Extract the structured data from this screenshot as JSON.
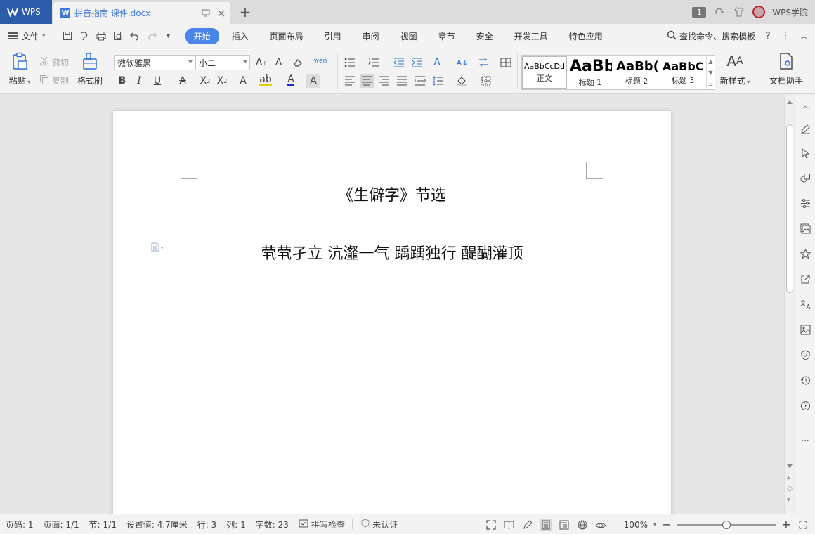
{
  "tabbar": {
    "home_label": "WPS",
    "doc_tab_title": "拼音指南 课件.docx",
    "window_count": "1",
    "academy_label": "WPS学院"
  },
  "menubar": {
    "file_label": "文件",
    "tabs": [
      "开始",
      "插入",
      "页面布局",
      "引用",
      "审阅",
      "视图",
      "章节",
      "安全",
      "开发工具",
      "特色应用"
    ],
    "active_tab": "开始",
    "search_label": "查找命令、搜索模板"
  },
  "ribbon": {
    "paste_label": "粘贴",
    "cut_label": "剪切",
    "copy_label": "复制",
    "format_painter_label": "格式刷",
    "font_name": "微软雅黑",
    "font_size": "小二",
    "styles": [
      {
        "sample": "AaBbCcDd",
        "name": "正文"
      },
      {
        "sample": "AaBb",
        "name": "标题 1"
      },
      {
        "sample": "AaBb(",
        "name": "标题 2"
      },
      {
        "sample": "AaBbC(",
        "name": "标题 3"
      }
    ],
    "new_style_label": "新样式",
    "doc_helper_label": "文档助手"
  },
  "document": {
    "title": "《生僻字》节选",
    "line1": "茕茕孑立  沆瀣一气  踽踽独行  醍醐灌顶"
  },
  "statusbar": {
    "page_num": "页码: 1",
    "pages": "页面: 1/1",
    "section": "节: 1/1",
    "setting": "设置值: 4.7厘米",
    "row": "行: 3",
    "col": "列: 1",
    "word_count": "字数: 23",
    "spell_check": "拼写检查",
    "certification": "未认证",
    "zoom": "100%"
  },
  "colors": {
    "accent": "#4a86e8",
    "home_tab": "#2b5ba9",
    "doc_tab_text": "#4a7fd6"
  }
}
